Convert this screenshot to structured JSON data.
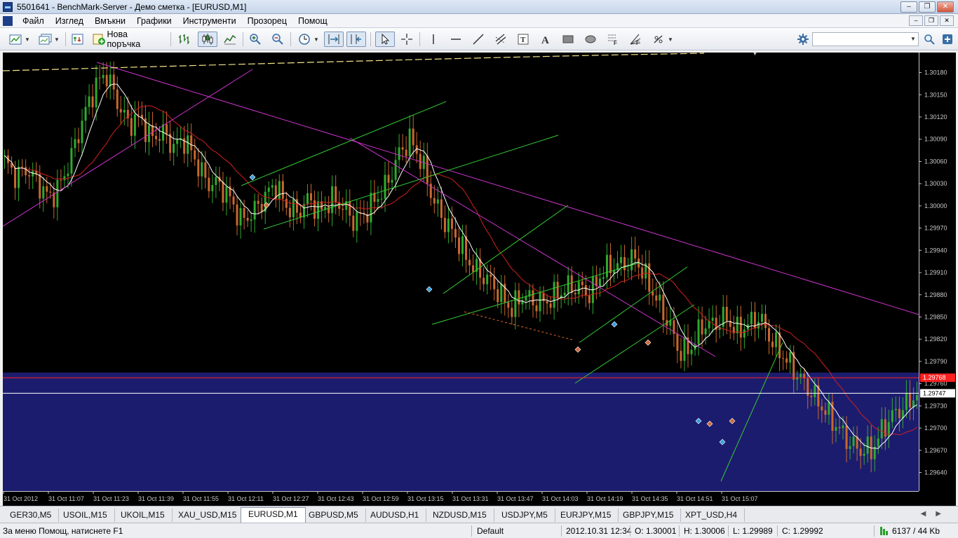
{
  "window": {
    "title": "5501641 - BenchMark-Server - Демо сметка - [EURUSD,M1]"
  },
  "menu": [
    "Файл",
    "Изглед",
    "Вмъкни",
    "Графики",
    "Инструменти",
    "Прозорец",
    "Помощ"
  ],
  "toolbar": {
    "new_order_label": "Нова поръчка"
  },
  "search": {
    "value": ""
  },
  "chart_data": {
    "type": "candlestick",
    "symbol": "EURUSD",
    "timeframe": "M1",
    "ylim": [
      1.2962,
      1.3022
    ],
    "price_ticks": [
      "1.30180",
      "1.30150",
      "1.30120",
      "1.30090",
      "1.30060",
      "1.30030",
      "1.30000",
      "1.29970",
      "1.29940",
      "1.29910",
      "1.29880",
      "1.29850",
      "1.29820",
      "1.29790",
      "1.29760",
      "1.29730",
      "1.29700",
      "1.29670",
      "1.29640"
    ],
    "time_ticks": [
      "31 Oct 2012",
      "31 Oct 11:07",
      "31 Oct 11:23",
      "31 Oct 11:39",
      "31 Oct 11:55",
      "31 Oct 12:11",
      "31 Oct 12:27",
      "31 Oct 12:43",
      "31 Oct 12:59",
      "31 Oct 13:15",
      "31 Oct 13:31",
      "31 Oct 13:47",
      "31 Oct 14:03",
      "31 Oct 14:19",
      "31 Oct 14:35",
      "31 Oct 14:51",
      "31 Oct 15:07"
    ],
    "ask_line": {
      "label": "1.29768",
      "value": 1.29768,
      "color": "#ff2020"
    },
    "bid_line": {
      "label": "1.29747",
      "value": 1.29747,
      "color": "#ffffff"
    },
    "zone": {
      "from": 1.296,
      "to": 1.29775,
      "color": "#1c1c6e"
    },
    "close_path": [
      1.3006,
      1.3004,
      1.3005,
      1.3003,
      1.3001,
      1.3003,
      1.3007,
      1.3012,
      1.3016,
      1.3018,
      1.3014,
      1.3011,
      1.3012,
      1.3009,
      1.301,
      1.3008,
      1.3009,
      1.3006,
      1.3003,
      1.3003,
      1.3001,
      1.2998,
      1.2999,
      1.3001,
      1.3003,
      1.3,
      1.2999,
      1.3001,
      1.2999,
      1.3001,
      1.3,
      1.2998,
      1.2999,
      1.3001,
      1.3003,
      1.3007,
      1.3009,
      1.3006,
      1.3001,
      1.2998,
      1.2996,
      1.2993,
      1.2991,
      1.299,
      1.2988,
      1.2986,
      1.2988,
      1.2987,
      1.2987,
      1.2988,
      1.2989,
      1.2989,
      1.2988,
      1.2991,
      1.2992,
      1.2992,
      1.2993,
      1.299,
      1.2987,
      1.2984,
      1.298,
      1.2981,
      1.2984,
      1.2984,
      1.2985,
      1.2983,
      1.2984,
      1.2985,
      1.2982,
      1.298,
      1.2978,
      1.2976,
      1.2974,
      1.2972,
      1.297,
      1.2968,
      1.2967,
      1.2967,
      1.297,
      1.2972,
      1.2973,
      1.29747
    ],
    "indicators": [
      "fast MA (white)",
      "slow MA (red)"
    ],
    "zoom_marker": "▼"
  },
  "tabs": [
    "GER30,M5",
    "USOIL,M15",
    "UKOIL,M15",
    "XAU_USD,M15",
    "EURUSD,M1",
    "GBPUSD,M5",
    "AUDUSD,H1",
    "NZDUSD,M15",
    "USDJPY,M5",
    "EURJPY,M15",
    "GBPJPY,M15",
    "XPT_USD,H4"
  ],
  "active_tab": "EURUSD,M1",
  "status": {
    "help": "За меню Помощ, натиснете F1",
    "profile": "Default",
    "datetime": "2012.10.31 12:34",
    "open": "O: 1.30001",
    "high": "H: 1.30006",
    "low": "L: 1.29989",
    "close": "C: 1.29992",
    "traffic": "6137 / 44 Kb"
  },
  "colors": {
    "bull": "#2faa2f",
    "bear": "#c9682e",
    "trend_magenta": "#cc33cc",
    "channel_green": "#33cc33",
    "bg": "#000000"
  }
}
